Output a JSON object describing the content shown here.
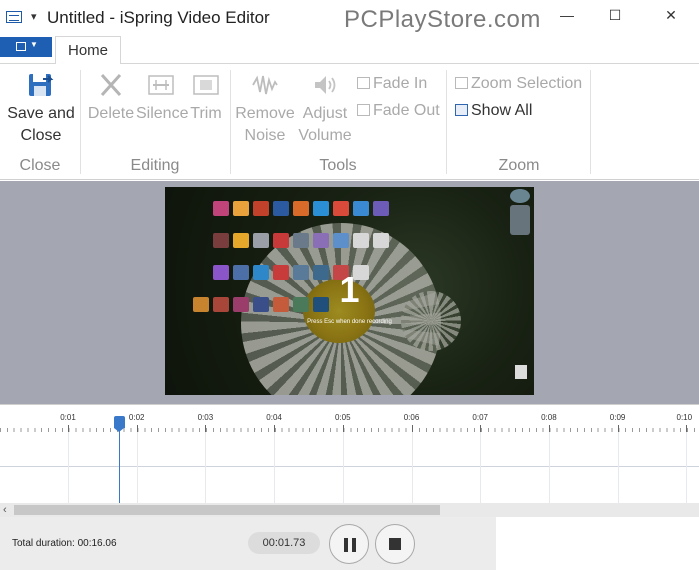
{
  "window": {
    "title": "Untitled - iSpring Video Editor",
    "watermark": "PCPlayStore.com",
    "minimize_glyph": "—",
    "maximize_glyph": "☐",
    "close_glyph": "✕"
  },
  "ribbon": {
    "tabs": [
      {
        "label": "Home",
        "active": true
      }
    ],
    "groups": {
      "close": {
        "label": "Close",
        "save_close_line1": "Save and",
        "save_close_line2": "Close"
      },
      "editing": {
        "label": "Editing",
        "delete": "Delete",
        "silence": "Silence",
        "trim": "Trim"
      },
      "tools": {
        "label": "Tools",
        "remove_noise_line1": "Remove",
        "remove_noise_line2": "Noise",
        "adjust_volume_line1": "Adjust",
        "adjust_volume_line2": "Volume",
        "fade_in": "Fade In",
        "fade_out": "Fade Out"
      },
      "zoom": {
        "label": "Zoom",
        "zoom_selection": "Zoom Selection",
        "show_all": "Show All"
      }
    }
  },
  "preview": {
    "countdown": "1",
    "message": "Press Esc when done recording"
  },
  "timeline": {
    "ticks": [
      "0:01",
      "0:02",
      "0:03",
      "0:04",
      "0:05",
      "0:06",
      "0:07",
      "0:08",
      "0:09",
      "0:10"
    ],
    "playhead_seconds": 1.73
  },
  "playback": {
    "total_duration": "Total duration: 00:16.06",
    "current_time": "00:01.73"
  },
  "colors": {
    "accent": "#1f5fb3",
    "playhead": "#3a79c9"
  }
}
